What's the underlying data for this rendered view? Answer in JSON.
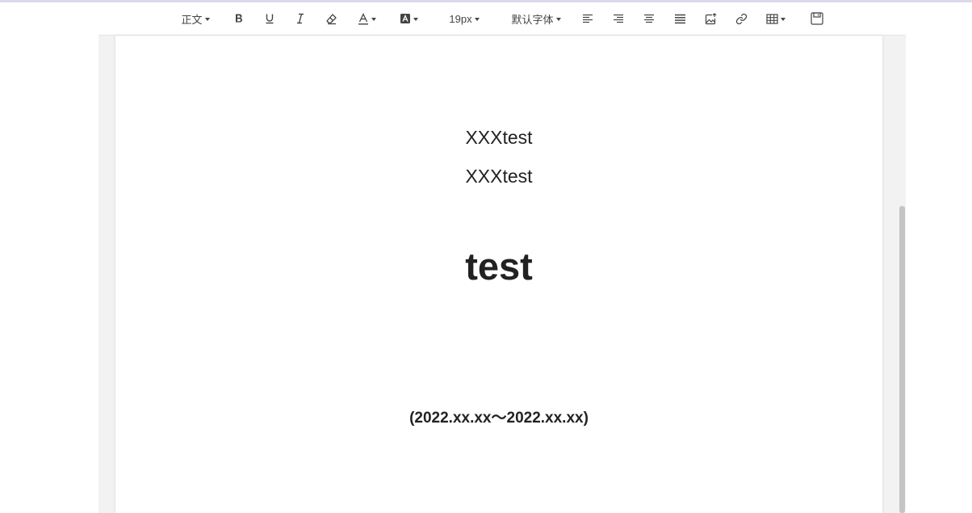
{
  "toolbar": {
    "paragraph_style": "正文",
    "font_size": "19px",
    "font_family": "默认字体"
  },
  "document": {
    "line1": "XXXtest",
    "line2": "XXXtest",
    "title": "test",
    "date_range": "(2022.xx.xx～2022.xx.xx)"
  },
  "colors": {
    "text": "#222222",
    "toolbar_icon": "#444444",
    "background": "#f2f2f2",
    "top_border": "#dcd8ec"
  }
}
